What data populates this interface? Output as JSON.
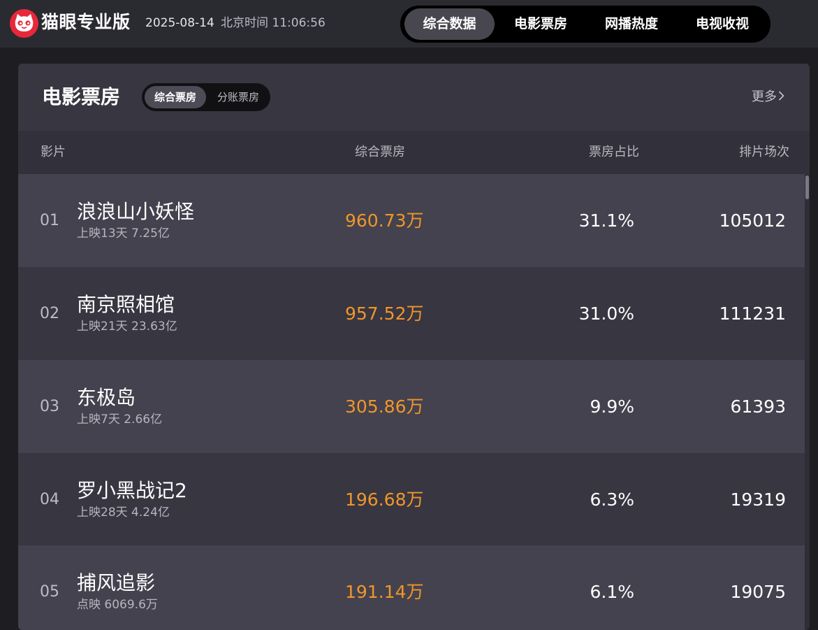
{
  "header": {
    "logo_text": "猫眼专业版",
    "date": "2025-08-14",
    "clock": "北京时间 11:06:56"
  },
  "nav": {
    "items": [
      {
        "label": "综合数据",
        "active": true
      },
      {
        "label": "电影票房",
        "active": false
      },
      {
        "label": "网播热度",
        "active": false
      },
      {
        "label": "电视收视",
        "active": false
      }
    ]
  },
  "panel": {
    "title": "电影票房",
    "segments": [
      {
        "label": "综合票房",
        "active": true
      },
      {
        "label": "分账票房",
        "active": false
      }
    ],
    "more_label": "更多",
    "columns": {
      "movie": "影片",
      "box_office": "综合票房",
      "share": "票房占比",
      "shows": "排片场次"
    },
    "rows": [
      {
        "rank": "01",
        "name": "浪浪山小妖怪",
        "sub": "上映13天  7.25亿",
        "box_office": "960.73万",
        "share": "31.1%",
        "shows": "105012"
      },
      {
        "rank": "02",
        "name": "南京照相馆",
        "sub": "上映21天  23.63亿",
        "box_office": "957.52万",
        "share": "31.0%",
        "shows": "111231"
      },
      {
        "rank": "03",
        "name": "东极岛",
        "sub": "上映7天  2.66亿",
        "box_office": "305.86万",
        "share": "9.9%",
        "shows": "61393"
      },
      {
        "rank": "04",
        "name": "罗小黑战记2",
        "sub": "上映28天  4.24亿",
        "box_office": "196.68万",
        "share": "6.3%",
        "shows": "19319"
      },
      {
        "rank": "05",
        "name": "捕风追影",
        "sub": "点映  6069.6万",
        "box_office": "191.14万",
        "share": "6.1%",
        "shows": "19075"
      }
    ]
  },
  "colors": {
    "accent_orange": "#f0962a",
    "logo_red": "#e8283a"
  }
}
